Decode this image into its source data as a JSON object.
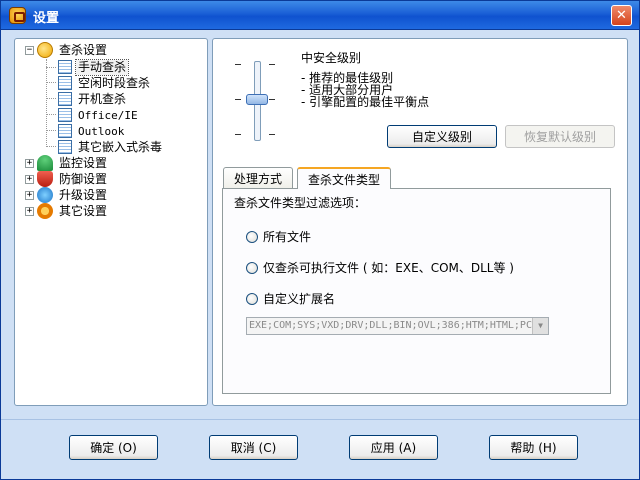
{
  "window": {
    "title": "设置"
  },
  "tree": {
    "root": {
      "label": "查杀设置",
      "expander": "−"
    },
    "children": [
      {
        "label": "手动查杀",
        "selected": true
      },
      {
        "label": "空闲时段查杀"
      },
      {
        "label": "开机查杀"
      },
      {
        "label": "Office/IE"
      },
      {
        "label": "Outlook"
      },
      {
        "label": "其它嵌入式杀毒"
      }
    ],
    "groups": [
      {
        "label": "监控设置",
        "expander": "+",
        "icon": "umbrella-icon"
      },
      {
        "label": "防御设置",
        "expander": "+",
        "icon": "shield-icon"
      },
      {
        "label": "升级设置",
        "expander": "+",
        "icon": "upgrade-icon"
      },
      {
        "label": "其它设置",
        "expander": "+",
        "icon": "gear-icon"
      }
    ]
  },
  "security": {
    "title": "中安全级别",
    "descriptions": [
      "- 推荐的最佳级别",
      "- 适用大部分用户",
      "- 引擎配置的最佳平衡点"
    ],
    "level": 2,
    "levels_total": 4,
    "custom_button": "自定义级别",
    "restore_button": "恢复默认级别"
  },
  "tabs": [
    {
      "label": "处理方式",
      "active": false
    },
    {
      "label": "查杀文件类型",
      "active": true
    }
  ],
  "filetypes": {
    "label": "查杀文件类型过滤选项：",
    "options": [
      "所有文件",
      "仅查杀可执行文件 ( 如：EXE、COM、DLL等 )",
      "自定义扩展名"
    ],
    "extensions": "EXE;COM;SYS;VXD;DRV;DLL;BIN;OVL;386;HTM;HTML;PC"
  },
  "footer": {
    "ok": "确定 (O)",
    "cancel": "取消 (C)",
    "apply": "应用 (A)",
    "help": "帮助 (H)"
  },
  "colors": {
    "titlebar": "#1a5fd6",
    "accent_tab": "#f5a623",
    "window_bg": "#cfe0f5"
  }
}
